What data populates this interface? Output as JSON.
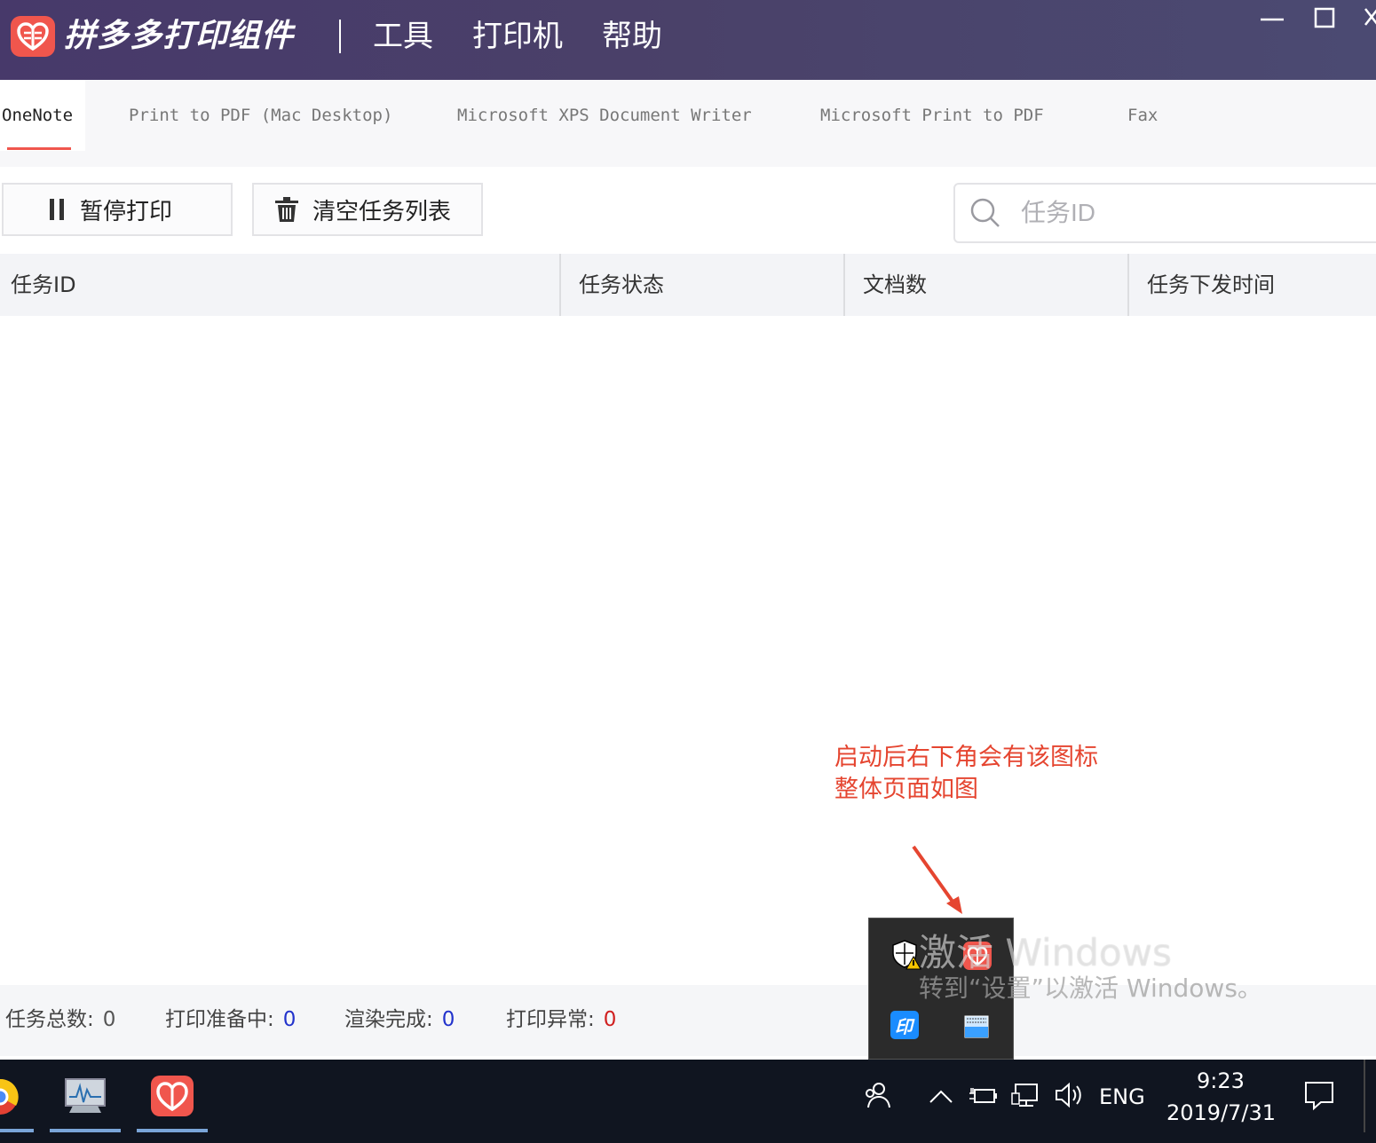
{
  "app": {
    "title": "拼多多打印组件",
    "menu": [
      "工具",
      "打印机",
      "帮助"
    ],
    "brand_color": "#f0564d"
  },
  "tabs": [
    {
      "label": "OneNote",
      "active": true
    },
    {
      "label": "Print to PDF (Mac Desktop)",
      "active": false
    },
    {
      "label": "Microsoft XPS Document Writer",
      "active": false
    },
    {
      "label": "Microsoft Print to PDF",
      "active": false
    },
    {
      "label": "Fax",
      "active": false
    }
  ],
  "toolbar": {
    "pause_label": "暂停打印",
    "pause_icon": "pause-icon",
    "clear_label": "清空任务列表",
    "clear_icon": "trash-icon",
    "search_placeholder": "任务ID",
    "search_icon": "search-icon"
  },
  "table": {
    "columns": [
      "任务ID",
      "任务状态",
      "文档数",
      "任务下发时间"
    ],
    "rows": []
  },
  "footer": {
    "total_label": "任务总数:",
    "total_value": "0",
    "preparing_label": "打印准备中:",
    "preparing_value": "0",
    "rendered_label": "渲染完成:",
    "rendered_value": "0",
    "error_label": "打印异常:",
    "error_value": "0",
    "value_color": "#2233cc",
    "error_color": "#d02020"
  },
  "annotation": {
    "line1": "启动后右下角会有该图标",
    "line2": "整体页面如图",
    "color": "#e54530"
  },
  "watermark": {
    "line1": "激活 Windows",
    "line2": "转到“设置”以激活 Windows。"
  },
  "taskbar": {
    "lang": "ENG",
    "time": "9:23",
    "date": "2019/7/31"
  }
}
